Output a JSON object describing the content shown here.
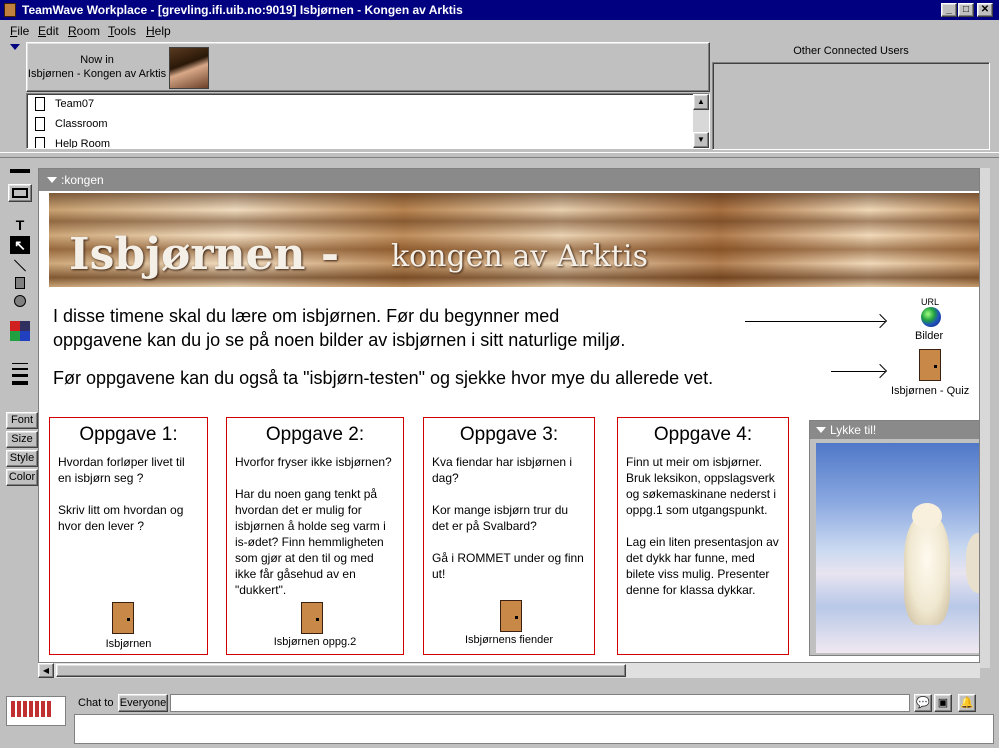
{
  "window": {
    "title": "TeamWave Workplace - [grevling.ifi.uib.no:9019] Isbjørnen - Kongen av Arktis",
    "buttons": {
      "minimize": "_",
      "maximize": "□",
      "close": "✕"
    }
  },
  "menu": [
    "File",
    "Edit",
    "Room",
    "Tools",
    "Help"
  ],
  "now_in": {
    "label": "Now in",
    "room": "Isbjørnen - Kongen av Arktis"
  },
  "rooms": [
    "Team07",
    "Classroom",
    "Help Room"
  ],
  "other_users": {
    "label": "Other Connected Users"
  },
  "side_buttons": [
    "Font",
    "Size",
    "Style",
    "Color"
  ],
  "room_header": ":kongen",
  "banner": {
    "title": "Isbjørnen -",
    "subtitle": "kongen av Arktis"
  },
  "intro": {
    "line1": "I disse timene skal du lære om isbjørnen. Før du begynner med",
    "line2": "oppgavene kan du jo se på noen bilder av isbjørnen i sitt naturlige miljø.",
    "line3": "Før oppgavene kan du også ta \"isbjørn-testen\" og sjekke hvor mye du allerede vet."
  },
  "links": {
    "url_label": "URL",
    "bilder": "Bilder",
    "quiz": "Isbjørnen - Quiz"
  },
  "tasks": [
    {
      "title": "Oppgave 1:",
      "text": "Hvordan forløper livet til en isbjørn seg ?\n\nSkriv litt om hvordan og hvor den lever ?",
      "door": "Isbjørnen"
    },
    {
      "title": "Oppgave 2:",
      "text": "Hvorfor fryser ikke isbjørnen?\n\nHar du noen gang tenkt på hvordan det er mulig for isbjørnen å holde seg varm i is-ødet? Finn hemmligheten som gjør at den til og med ikke får gåsehud av en \"dukkert\".",
      "door": "Isbjørnen oppg.2"
    },
    {
      "title": "Oppgave 3:",
      "text": "Kva fiendar har isbjørnen i dag?\n\nKor mange isbjørn trur du det er på Svalbard?\n\nGå i ROMMET under og finn ut!",
      "door": "Isbjørnens fiender"
    },
    {
      "title": "Oppgave 4:",
      "text": "Finn ut meir om isbjørner. Bruk leksikon, oppslagsverk og  søkemaskinane nederst i oppg.1 som utgangspunkt.\n\nLag ein liten presentasjon av det dykk har funne, med bilete viss mulig. Presenter denne for klassa dykkar.",
      "door": ""
    }
  ],
  "image_panel": {
    "title": "Lykke til!"
  },
  "chat": {
    "label": "Chat to",
    "target": "Everyone",
    "input_value": ""
  }
}
